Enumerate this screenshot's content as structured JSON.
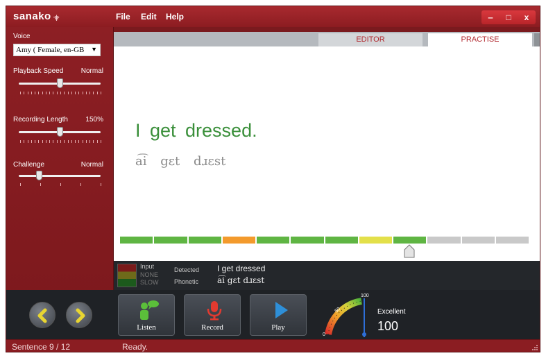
{
  "app": {
    "logo_text": "sanako",
    "logo_wave": "·ı|ı·"
  },
  "menu": [
    "File",
    "Edit",
    "Help"
  ],
  "window_controls": [
    "‒",
    "□",
    "x"
  ],
  "left_panel": {
    "voice_label": "Voice",
    "voice_value": "Amy ( Female, en-GB",
    "playback_label": "Playback Speed",
    "playback_value": "Normal",
    "playback_level": 0.5,
    "recording_label": "Recording Length",
    "recording_value": "150%",
    "recording_level": 0.5,
    "challenge_label": "Challenge",
    "challenge_value": "Normal",
    "challenge_level": 0.25
  },
  "tabs": {
    "editor": "EDITOR",
    "practise": "PRACTISE",
    "active": "PRACTISE"
  },
  "practise": {
    "sentence": "I get dressed.",
    "phonetic": "a͡i gɛt dɹɛst",
    "score_segments": [
      "#5fb543",
      "#5fb543",
      "#5fb543",
      "#f39a2c",
      "#5fb543",
      "#5fb543",
      "#5fb543",
      "#e3e04a",
      "#5fb543",
      "#c9c9c9",
      "#c9c9c9",
      "#c9c9c9"
    ],
    "marker_segment": 9
  },
  "detection": {
    "input_label": "Input",
    "input_none": "NONE",
    "input_slow": "SLOW",
    "detected_label": "Detected",
    "detected_value": "I get dressed",
    "phonetic_label": "Phonetic",
    "phonetic_value": "a͡i gɛt dɹɛst"
  },
  "controls": {
    "listen": "Listen",
    "record": "Record",
    "play": "Play",
    "gauge_max": "100",
    "gauge_mid": "50",
    "gauge_min": "0",
    "score_label": "Excellent",
    "score_value": "100"
  },
  "status": {
    "sentence_count": "Sentence 9 / 12",
    "text": "Ready."
  },
  "colors": {
    "brand_red": "#8b1d22",
    "sentence_green": "#3a8f3a",
    "tab_text": "#b0262c",
    "nav_arrow_yellow": "#e8d531",
    "record_red": "#e23a30",
    "play_blue": "#2e8fd8",
    "listen_green": "#5bbf3a"
  }
}
